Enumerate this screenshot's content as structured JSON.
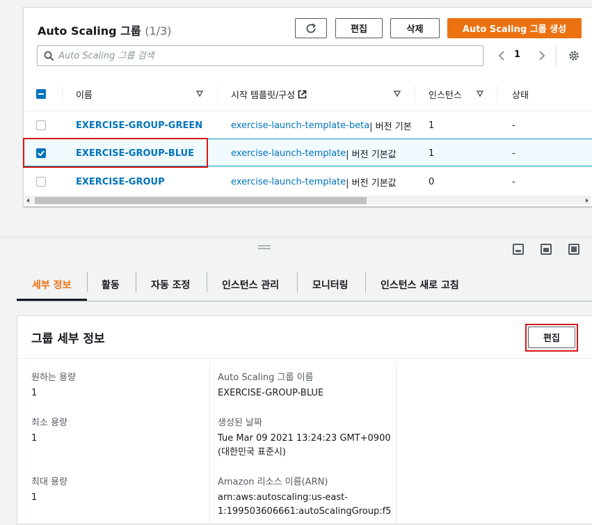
{
  "panel": {
    "title": "Auto Scaling 그룹",
    "count": "(1/3)",
    "edit_label": "편집",
    "delete_label": "삭제",
    "create_label": "Auto Scaling 그룹 생성"
  },
  "search": {
    "placeholder": "Auto Scaling 그룹 검색"
  },
  "pagination": {
    "page": "1"
  },
  "table": {
    "columns": [
      "이름",
      "시작 템플릿/구성",
      "인스턴스",
      "상태"
    ],
    "rows": [
      {
        "name": "EXERCISE-GROUP-GREEN",
        "template": "exercise-launch-template-beta",
        "version": " | 버전 기본",
        "instances": "1",
        "status": "-",
        "selected": false
      },
      {
        "name": "EXERCISE-GROUP-BLUE",
        "template": "exercise-launch-template",
        "version": " | 버전 기본값",
        "instances": "1",
        "status": "-",
        "selected": true
      },
      {
        "name": "EXERCISE-GROUP",
        "template": "exercise-launch-template",
        "version": " | 버전 기본값",
        "instances": "0",
        "status": "-",
        "selected": false
      }
    ]
  },
  "tabs": [
    "세부 정보",
    "활동",
    "자동 조정",
    "인스턴스 관리",
    "모니터링",
    "인스턴스 새로 고침"
  ],
  "details": {
    "title": "그룹 세부 정보",
    "edit_label": "편집",
    "desired_label": "원하는 용량",
    "desired_value": "1",
    "min_label": "최소 용량",
    "min_value": "1",
    "max_label": "최대 용량",
    "max_value": "1",
    "asg_name_label": "Auto Scaling 그룹 이름",
    "asg_name_value": "EXERCISE-GROUP-BLUE",
    "created_label": "생성된 날짜",
    "created_value_1": "Tue Mar 09 2021 13:24:23 GMT+0900",
    "created_value_2": "(대한민국 표준시)",
    "arn_label": "Amazon 리소스 이름(ARN)",
    "arn_value_1": "arn:aws:autoscaling:us-east-",
    "arn_value_2": "1:199503606661:autoScalingGroup:f5"
  },
  "colors": {
    "accent": "#ec7211",
    "link": "#0073bb",
    "highlight": "#d91515"
  }
}
